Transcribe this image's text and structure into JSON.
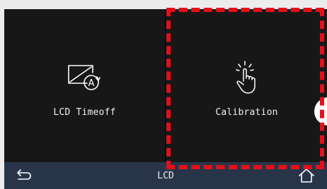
{
  "tiles": [
    {
      "label": "LCD Timeoff",
      "icon": "lcd-timeoff-icon"
    },
    {
      "label": "Calibration",
      "icon": "touch-calibration-icon"
    }
  ],
  "bottom_bar": {
    "title": "LCD",
    "back_icon": "back-icon",
    "home_icon": "home-icon"
  },
  "colors": {
    "screen_background": "#0a0a0a",
    "tile_background": "#171717",
    "bottom_bar": "#283549",
    "highlight": "#e3101b",
    "text": "#f0f0f0"
  }
}
